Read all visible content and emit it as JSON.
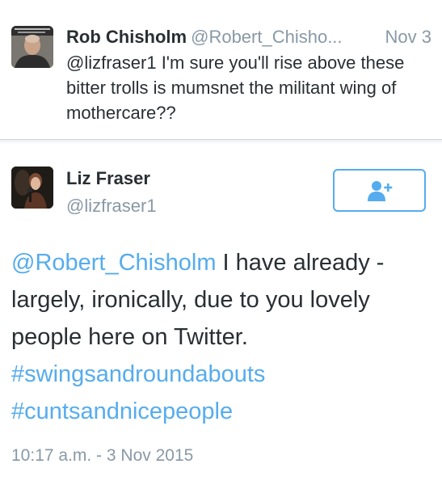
{
  "reply": {
    "name": "Rob Chisholm",
    "handle": "@Robert_Chisho...",
    "date": "Nov 3",
    "text": "@lizfraser1 I'm sure you'll rise above these bitter trolls is mumsnet the militant wing of mothercare??"
  },
  "tweet": {
    "name": "Liz Fraser",
    "handle": "@lizfraser1",
    "mention": "@Robert_Chisholm",
    "text": " I have already - largely, ironically, due to you lovely people here on Twitter. ",
    "hashtag_1": "#swingsandroundabouts",
    "hashtag_2": "#cuntsandnicepeople",
    "timestamp": "10:17 a.m. - 3 Nov 2015"
  },
  "follow_button": {
    "icon": "add-user-icon",
    "color": "#55acee"
  },
  "colors": {
    "accent": "#55acee",
    "text": "#292f33",
    "muted": "#8899a6",
    "divider": "#d6d6da"
  }
}
